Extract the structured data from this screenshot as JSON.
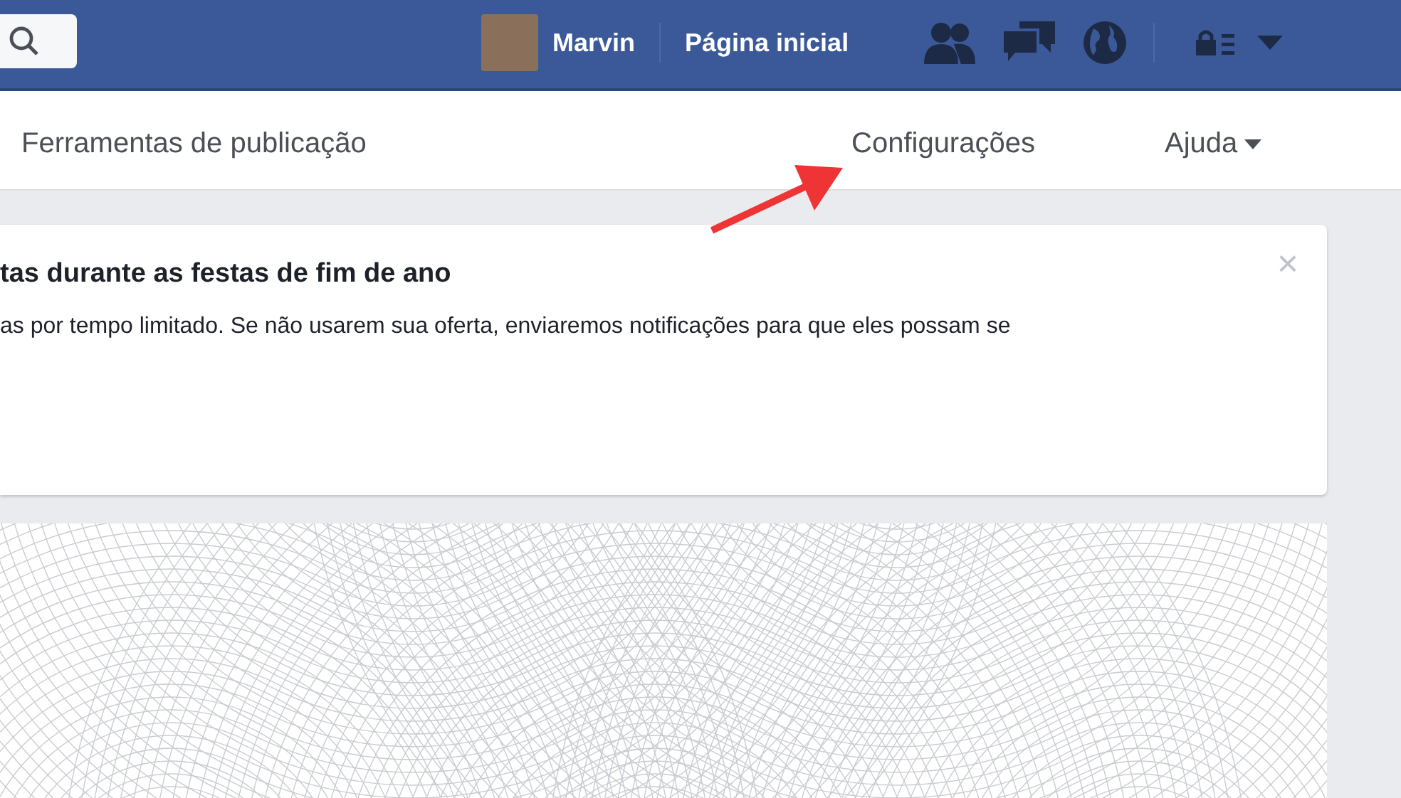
{
  "top_bar": {
    "user_name": "Marvin",
    "home_link": "Página inicial"
  },
  "nav": [
    {
      "label": "Ferramentas de publicação",
      "kind": "link"
    },
    {
      "label": "Configurações",
      "kind": "link"
    },
    {
      "label": "Ajuda",
      "kind": "dropdown"
    }
  ],
  "notice": {
    "title": "tas durante as festas de fim de ano",
    "body": "as por tempo limitado. Se não usarem sua oferta, enviaremos notificações para que eles possam se",
    "close": "×"
  }
}
